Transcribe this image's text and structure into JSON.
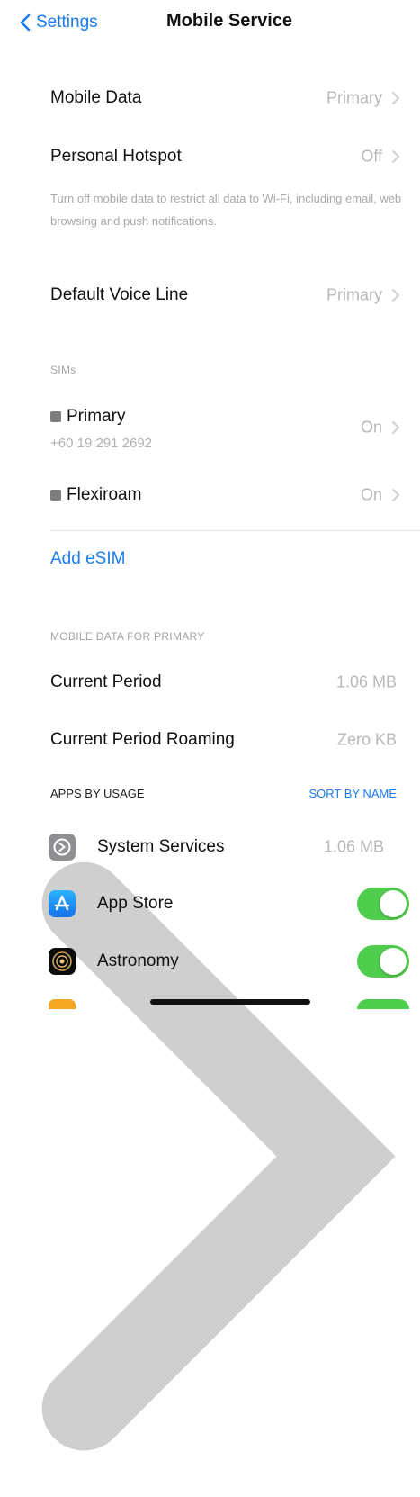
{
  "nav": {
    "back_label": "Settings",
    "title": "Mobile Service"
  },
  "rows": {
    "mobile_data": {
      "label": "Mobile Data",
      "value": "Primary"
    },
    "personal_hotspot": {
      "label": "Personal Hotspot",
      "value": "Off"
    },
    "footnote": "Turn off mobile data to restrict all data to Wi-Fi, including email, web browsing and push notifications.",
    "default_voice_line": {
      "label": "Default Voice Line",
      "value": "Primary"
    }
  },
  "sims": {
    "header": "SIMs",
    "items": [
      {
        "label": "Primary",
        "sublabel": "+60 19 291 2692",
        "value": "On"
      },
      {
        "label": "Flexiroam",
        "value": "On"
      }
    ],
    "add_esim": "Add eSIM"
  },
  "mobile_data_section": {
    "header": "MOBILE DATA FOR PRIMARY",
    "current_period": {
      "label": "Current Period",
      "value": "1.06 MB"
    },
    "current_period_roaming": {
      "label": "Current Period Roaming",
      "value": "Zero KB"
    }
  },
  "apps": {
    "header": "APPS BY USAGE",
    "sort_label": "SORT BY NAME",
    "items": [
      {
        "label": "System Services",
        "value": "1.06 MB",
        "icon": "gear-icon"
      },
      {
        "label": "App Store",
        "toggle": true,
        "icon": "app-store-icon"
      },
      {
        "label": "Astronomy",
        "toggle": true,
        "icon": "astronomy-icon"
      }
    ]
  },
  "colors": {
    "accent": "#1a7cf0",
    "toggle_on": "#4fcd4d",
    "secondary_text": "#b8b8b8"
  }
}
